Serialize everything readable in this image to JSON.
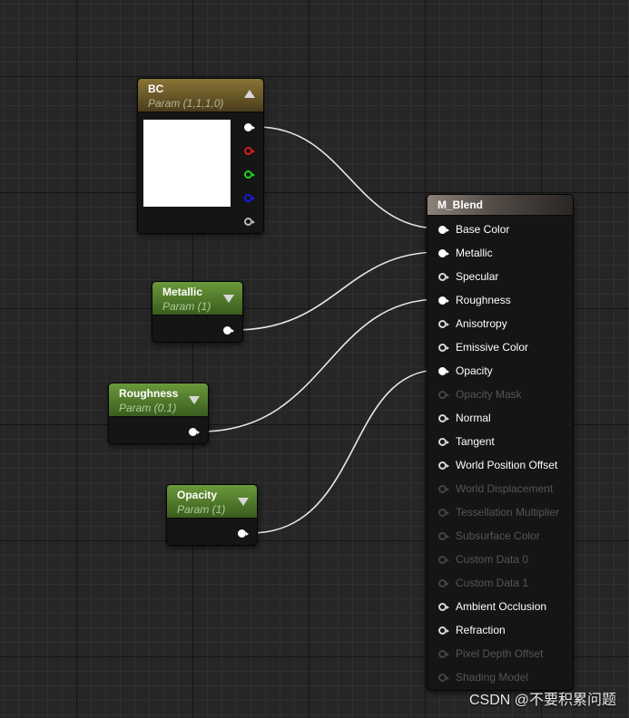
{
  "nodes": {
    "bc": {
      "title": "BC",
      "subtitle": "Param (1,1,1,0)"
    },
    "metallic": {
      "title": "Metallic",
      "subtitle": "Param (1)"
    },
    "roughness": {
      "title": "Roughness",
      "subtitle": "Param (0.1)"
    },
    "opacity": {
      "title": "Opacity",
      "subtitle": "Param (1)"
    }
  },
  "material": {
    "title": "M_Blend",
    "inputs": [
      {
        "label": "Base Color",
        "connected": true,
        "enabled": true
      },
      {
        "label": "Metallic",
        "connected": true,
        "enabled": true
      },
      {
        "label": "Specular",
        "connected": false,
        "enabled": true
      },
      {
        "label": "Roughness",
        "connected": true,
        "enabled": true
      },
      {
        "label": "Anisotropy",
        "connected": false,
        "enabled": true
      },
      {
        "label": "Emissive Color",
        "connected": false,
        "enabled": true
      },
      {
        "label": "Opacity",
        "connected": true,
        "enabled": true
      },
      {
        "label": "Opacity Mask",
        "connected": false,
        "enabled": false
      },
      {
        "label": "Normal",
        "connected": false,
        "enabled": true
      },
      {
        "label": "Tangent",
        "connected": false,
        "enabled": true
      },
      {
        "label": "World Position Offset",
        "connected": false,
        "enabled": true
      },
      {
        "label": "World Displacement",
        "connected": false,
        "enabled": false
      },
      {
        "label": "Tessellation Multiplier",
        "connected": false,
        "enabled": false
      },
      {
        "label": "Subsurface Color",
        "connected": false,
        "enabled": false
      },
      {
        "label": "Custom Data 0",
        "connected": false,
        "enabled": false
      },
      {
        "label": "Custom Data 1",
        "connected": false,
        "enabled": false
      },
      {
        "label": "Ambient Occlusion",
        "connected": false,
        "enabled": true
      },
      {
        "label": "Refraction",
        "connected": false,
        "enabled": true
      },
      {
        "label": "Pixel Depth Offset",
        "connected": false,
        "enabled": false
      },
      {
        "label": "Shading Model",
        "connected": false,
        "enabled": false
      }
    ]
  },
  "colors": {
    "wire": "#e8e8e8",
    "vector_header": "#8a7435",
    "scalar_header": "#6a9a3a",
    "pin_red": "#e01818",
    "pin_green": "#18d818",
    "pin_blue": "#1a1ae8"
  },
  "watermark": "CSDN @不要积累问题"
}
